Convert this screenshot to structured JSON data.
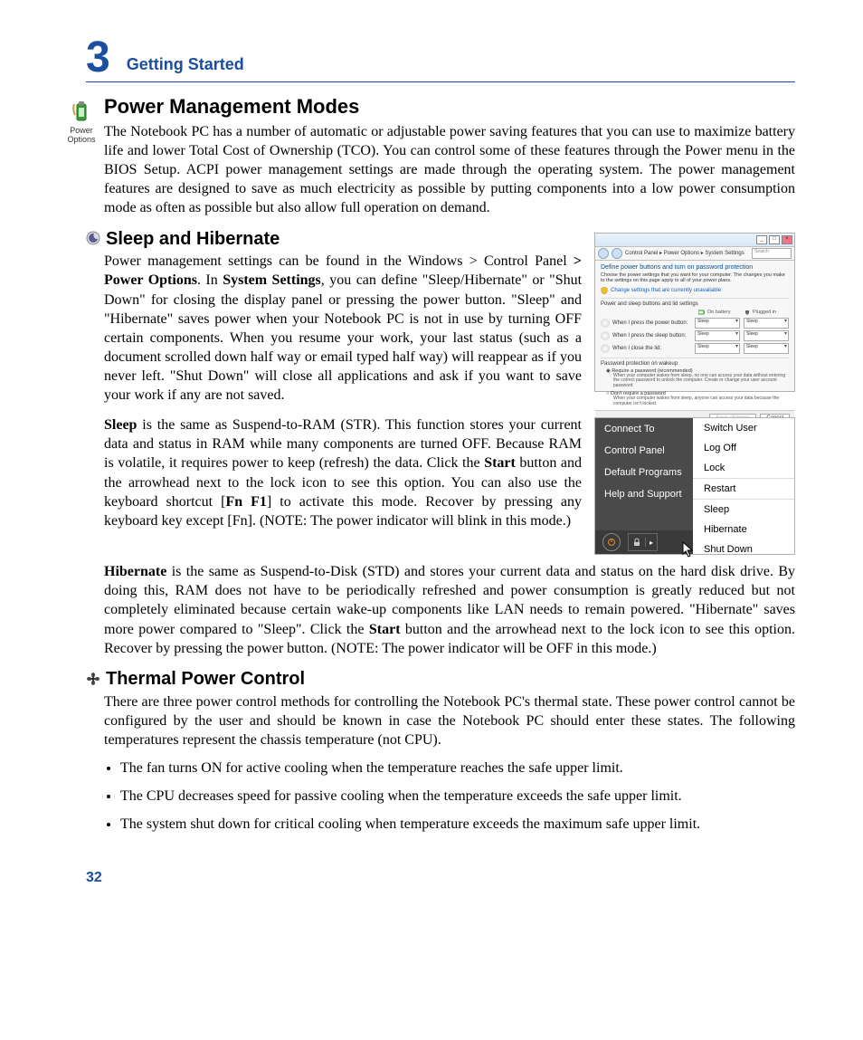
{
  "chapter": {
    "number": "3",
    "title": "Getting Started"
  },
  "icon_label": "Power Options",
  "h_power_mgmt": "Power Management Modes",
  "p_power_mgmt": "The Notebook PC has a number of automatic or adjustable power saving features that you can use to maximize battery life and lower Total Cost of Ownership (TCO). You can control some of these features through the Power menu in the BIOS Setup. ACPI power management settings are made through the operating system. The power management features are designed to save as much electricity as possible by putting components into a low power consumption mode as often as possible but also allow full operation on demand.",
  "h_sleep": "Sleep and Hibernate",
  "p_sleep1_a": "Power management settings can be found in the Windows > Control Panel ",
  "p_sleep1_b": "> Power Options",
  "p_sleep1_c": ". In ",
  "p_sleep1_d": "System Settings",
  "p_sleep1_e": ", you can define \"Sleep/Hibernate\" or \"Shut Down\" for closing the display panel or pressing the power button. \"Sleep\" and \"Hibernate\" saves power when your Notebook PC is not in use by turning OFF certain components. When you resume your work, your last status (such as a document scrolled down half way or email typed half way) will reappear as if you never left. \"Shut Down\" will close all applications and ask if you want to save your work if any are not saved.",
  "p_sleep2_a": "Sleep",
  "p_sleep2_b": " is the same as Suspend-to-RAM (STR). This function stores your current data and status in RAM while many components are turned OFF. Because RAM is volatile, it requires power to keep (refresh) the data. Click the ",
  "p_sleep2_c": "Start",
  "p_sleep2_d": " button and the arrowhead next to the lock icon to see this option. You can also use the keyboard shortcut [",
  "p_sleep2_e": "Fn F1",
  "p_sleep2_f": "] to activate this mode. Recover by pressing any keyboard key except [Fn]. (NOTE: The power indicator will blink in this mode.)",
  "p_hib_a": "Hibernate",
  "p_hib_b": " is the same as  Suspend-to-Disk (STD) and stores your current data and status on the hard disk drive. By doing this, RAM does not have to be periodically refreshed and power consumption is greatly reduced but not completely eliminated because certain wake-up components like LAN needs to remain powered. \"Hibernate\" saves more power compared to \"Sleep\". Click the ",
  "p_hib_c": "Start",
  "p_hib_d": " button and the arrowhead next to the lock icon to see this option. Recover by pressing the power button. (NOTE: The power indicator will be OFF in this mode.)",
  "h_thermal": "Thermal Power Control",
  "p_thermal": "There are three power control methods for controlling the Notebook PC's thermal state. These power control cannot be configured by the user and should be known in case the Notebook PC should enter these states. The following temperatures represent the chassis temperature (not CPU).",
  "bullets": [
    "The fan turns ON for active cooling when the temperature reaches the safe upper limit.",
    "The CPU decreases speed for passive cooling when the temperature exceeds the safe upper limit.",
    "The system shut down for critical cooling when temperature exceeds the maximum safe upper limit."
  ],
  "page_number": "32",
  "settings_window": {
    "breadcrumb": "Control Panel  ▸  Power Options  ▸  System Settings",
    "search_placeholder": "Search",
    "heading": "Define power buttons and turn on password protection",
    "sub": "Choose the power settings that you want for your computer. The changes you make to the settings on this page apply to all of your power plans.",
    "link": "Change settings that are currently unavailable",
    "section1": "Power and sleep buttons and lid settings",
    "col_battery": "On battery",
    "col_plugged": "Plugged in",
    "rows": [
      {
        "label": "When I press the power button:",
        "opt": "Sleep"
      },
      {
        "label": "When I press the sleep button:",
        "opt": "Sleep"
      },
      {
        "label": "When I close the lid:",
        "opt": "Sleep"
      }
    ],
    "section2": "Password protection on wakeup",
    "radio1": "Require a password (recommended)",
    "note1": "When your computer wakes from sleep, no one can access your data without entering the correct password to unlock the computer. Create or change your user account password",
    "radio2": "Don't require a password",
    "note2": "When your computer wakes from sleep, anyone can access your data because the computer isn't locked.",
    "btn_save": "Save changes",
    "btn_cancel": "Cancel"
  },
  "start_menu": {
    "left": [
      "Connect To",
      "Control Panel",
      "Default Programs",
      "Help and Support"
    ],
    "right": [
      "Switch User",
      "Log Off",
      "Lock",
      "Restart",
      "Sleep",
      "Hibernate",
      "Shut Down"
    ]
  }
}
